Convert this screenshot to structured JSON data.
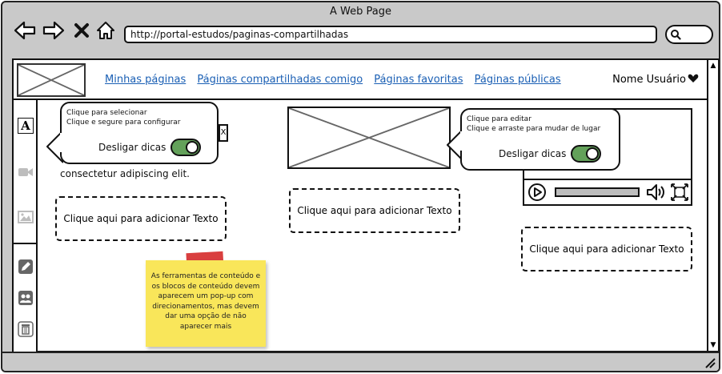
{
  "window": {
    "title": "A Web Page"
  },
  "browser": {
    "url": "http://portal-estudos/paginas-compartilhadas",
    "icons": [
      "back-arrow-icon",
      "forward-arrow-icon",
      "stop-x-icon",
      "home-icon",
      "search-icon"
    ]
  },
  "header": {
    "nav": [
      {
        "label": "Minhas páginas"
      },
      {
        "label": "Páginas compartilhadas comigo"
      },
      {
        "label": "Páginas favoritas"
      },
      {
        "label": "Páginas públicas"
      }
    ],
    "user": {
      "name": "Nome Usuário",
      "icon": "heart-icon"
    }
  },
  "toolbar": {
    "tools": [
      {
        "name": "text-tool",
        "icon": "text-A-icon",
        "glyph": "A"
      },
      {
        "name": "video-tool",
        "icon": "video-camera-icon"
      },
      {
        "name": "image-tool",
        "icon": "image-icon"
      },
      {
        "name": "edit-tool",
        "icon": "pencil-icon"
      },
      {
        "name": "users-tool",
        "icon": "users-icon"
      },
      {
        "name": "delete-tool",
        "icon": "trash-icon"
      }
    ]
  },
  "content": {
    "lorem": [
      "consectetur adipiscing elit."
    ],
    "add_text": "Clique aqui para adicionar Texto",
    "close_glyph": "X"
  },
  "popup_left": {
    "line1": "Clique para selecionar",
    "line2": "Clique e segure para configurar",
    "toggle_label": "Desligar dicas",
    "toggle_on": true
  },
  "popup_right": {
    "line1": "Clique para editar",
    "line2": "Clique e arraste para mudar de lugar",
    "toggle_label": "Desligar dicas",
    "toggle_on": true
  },
  "sticky_note": {
    "text": "As ferramentas de conteúdo e os blocos de conteúdo devem aparecem um pop-up com direcionamentos, mas devem dar uma opção de não aparecer mais"
  },
  "colors": {
    "link": "#1a5fb4",
    "toggle_on": "#63a15a",
    "sticky": "#f9e65a",
    "tape": "#d62f2f",
    "chrome": "#c9c9c9"
  }
}
